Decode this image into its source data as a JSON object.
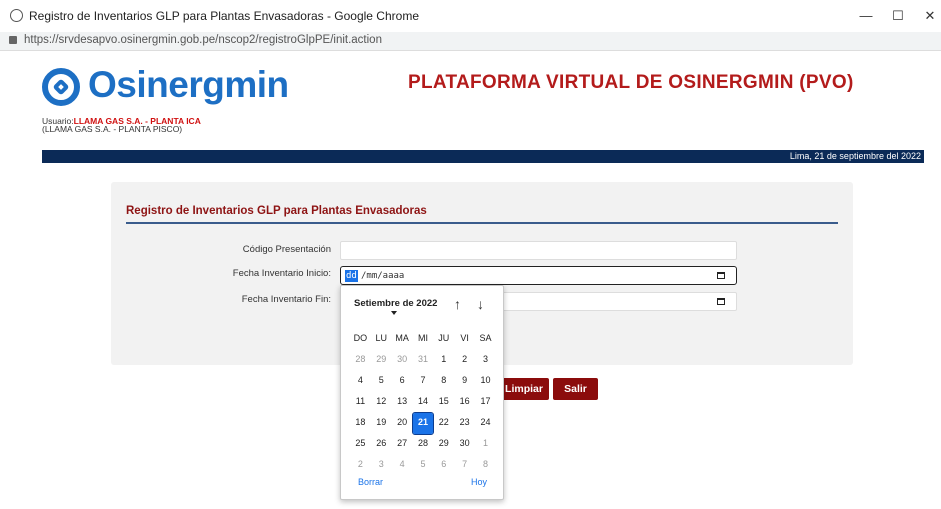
{
  "window": {
    "title": "Registro de Inventarios GLP para Plantas Envasadoras - Google Chrome",
    "url": "https://srvdesapvo.osinergmin.gob.pe/nscop2/registroGlpPE/init.action",
    "minimize": "—",
    "maximize": "☐",
    "close": "✕"
  },
  "header": {
    "brand": "Osinergmin",
    "platform_title": "PLATAFORMA VIRTUAL DE OSINERGMIN (PVO)",
    "user_prefix": "Usuario:",
    "user_name": "LLAMA GAS S.A. - PLANTA ICA",
    "user_plant": "(LLAMA GAS S.A. - PLANTA PISCO)",
    "date": "Lima, 21 de septiembre del 2022"
  },
  "form": {
    "heading": "Registro de Inventarios GLP para Plantas Envasadoras",
    "codigo_label": "Código Presentación",
    "codigo_value": "",
    "inicio_label": "Fecha Inventario Inicio:",
    "inicio_dd": "dd",
    "inicio_rest": "/mm/aaaa",
    "fin_label": "Fecha Inventario Fin:",
    "limpiar_label": "Limpiar",
    "salir_label": "Salir"
  },
  "datepicker": {
    "month_label": "Setiembre de 2022",
    "up_arrow": "↑",
    "down_arrow": "↓",
    "weekdays": [
      "DO",
      "LU",
      "MA",
      "MI",
      "JU",
      "VI",
      "SA"
    ],
    "weeks": [
      [
        "28",
        "29",
        "30",
        "31",
        "1",
        "2",
        "3"
      ],
      [
        "4",
        "5",
        "6",
        "7",
        "8",
        "9",
        "10"
      ],
      [
        "11",
        "12",
        "13",
        "14",
        "15",
        "16",
        "17"
      ],
      [
        "18",
        "19",
        "20",
        "21",
        "22",
        "23",
        "24"
      ],
      [
        "25",
        "26",
        "27",
        "28",
        "29",
        "30",
        "1"
      ],
      [
        "2",
        "3",
        "4",
        "5",
        "6",
        "7",
        "8"
      ]
    ],
    "selected_day": "21",
    "clear_label": "Borrar",
    "today_label": "Hoy"
  },
  "colors": {
    "brand_blue": "#1d6fc4",
    "title_red": "#b31b1b",
    "nav_band": "#0b2a57",
    "button_red": "#8b0c0c",
    "selection_blue": "#1a73e8"
  }
}
